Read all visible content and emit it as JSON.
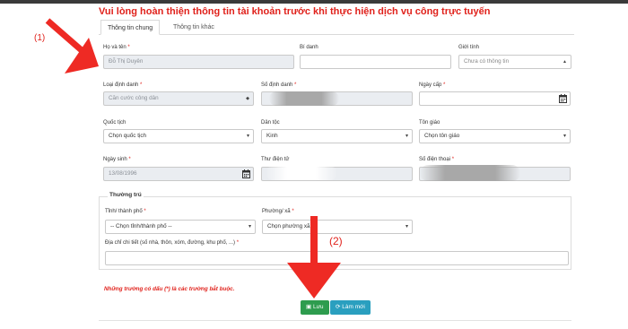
{
  "banner": "Vui lòng hoàn thiện thông tin tài khoản trước khi thực hiện dịch vụ công trực tuyến",
  "tabs": [
    "Thông tin chung",
    "Thông tin khác"
  ],
  "form": {
    "ho_ten": {
      "label": "Họ và tên",
      "value": "Đỗ Thị Duyên"
    },
    "bi_danh": {
      "label": "Bí danh",
      "value": ""
    },
    "gioi_tinh": {
      "label": "Giới tính",
      "value": "Chưa có thông tin"
    },
    "loai_dinh_danh": {
      "label": "Loại định danh",
      "value": "Căn cước công dân"
    },
    "so_dinh_danh": {
      "label": "Số định danh",
      "value": ""
    },
    "ngay_cap": {
      "label": "Ngày cấp",
      "value": ""
    },
    "quoc_tich": {
      "label": "Quốc tịch",
      "value": "Chọn quốc tịch"
    },
    "dan_toc": {
      "label": "Dân tộc",
      "value": "Kinh"
    },
    "ton_giao": {
      "label": "Tôn giáo",
      "value": "Chọn tôn giáo"
    },
    "ngay_sinh": {
      "label": "Ngày sinh",
      "value": "13/08/1996"
    },
    "thu_dien_tu": {
      "label": "Thư điện tử",
      "value": ""
    },
    "so_dien_thoai": {
      "label": "Số điện thoại",
      "value": ""
    }
  },
  "thuong_tru": {
    "title": "Thường trú",
    "tinh": {
      "label": "Tỉnh/ thành phố",
      "value": "-- Chọn tỉnh/thành phố --"
    },
    "phuong": {
      "label": "Phường/ xã",
      "value": "Chọn phường xã"
    },
    "dia_chi": {
      "label": "Địa chỉ chi tiết (số nhà, thôn, xóm, đường, khu phố, ...)",
      "value": ""
    }
  },
  "required_mark": "*",
  "note": "Những trường có dấu (*) là các trường bắt buộc.",
  "buttons": {
    "save": "Lưu",
    "reset": "Làm mới"
  },
  "annotations": {
    "a1": "(1)",
    "a2": "(2)"
  },
  "colors": {
    "annotation": "#e0211b",
    "save": "#2e9c4e",
    "reset": "#2a9fbf",
    "disabled_bg": "#eaedf1"
  },
  "icons": {
    "calendar": "calendar-icon",
    "caret": "select-caret-icon",
    "save": "floppy-disk-icon",
    "reset": "refresh-icon",
    "arrow": "red-arrow"
  }
}
